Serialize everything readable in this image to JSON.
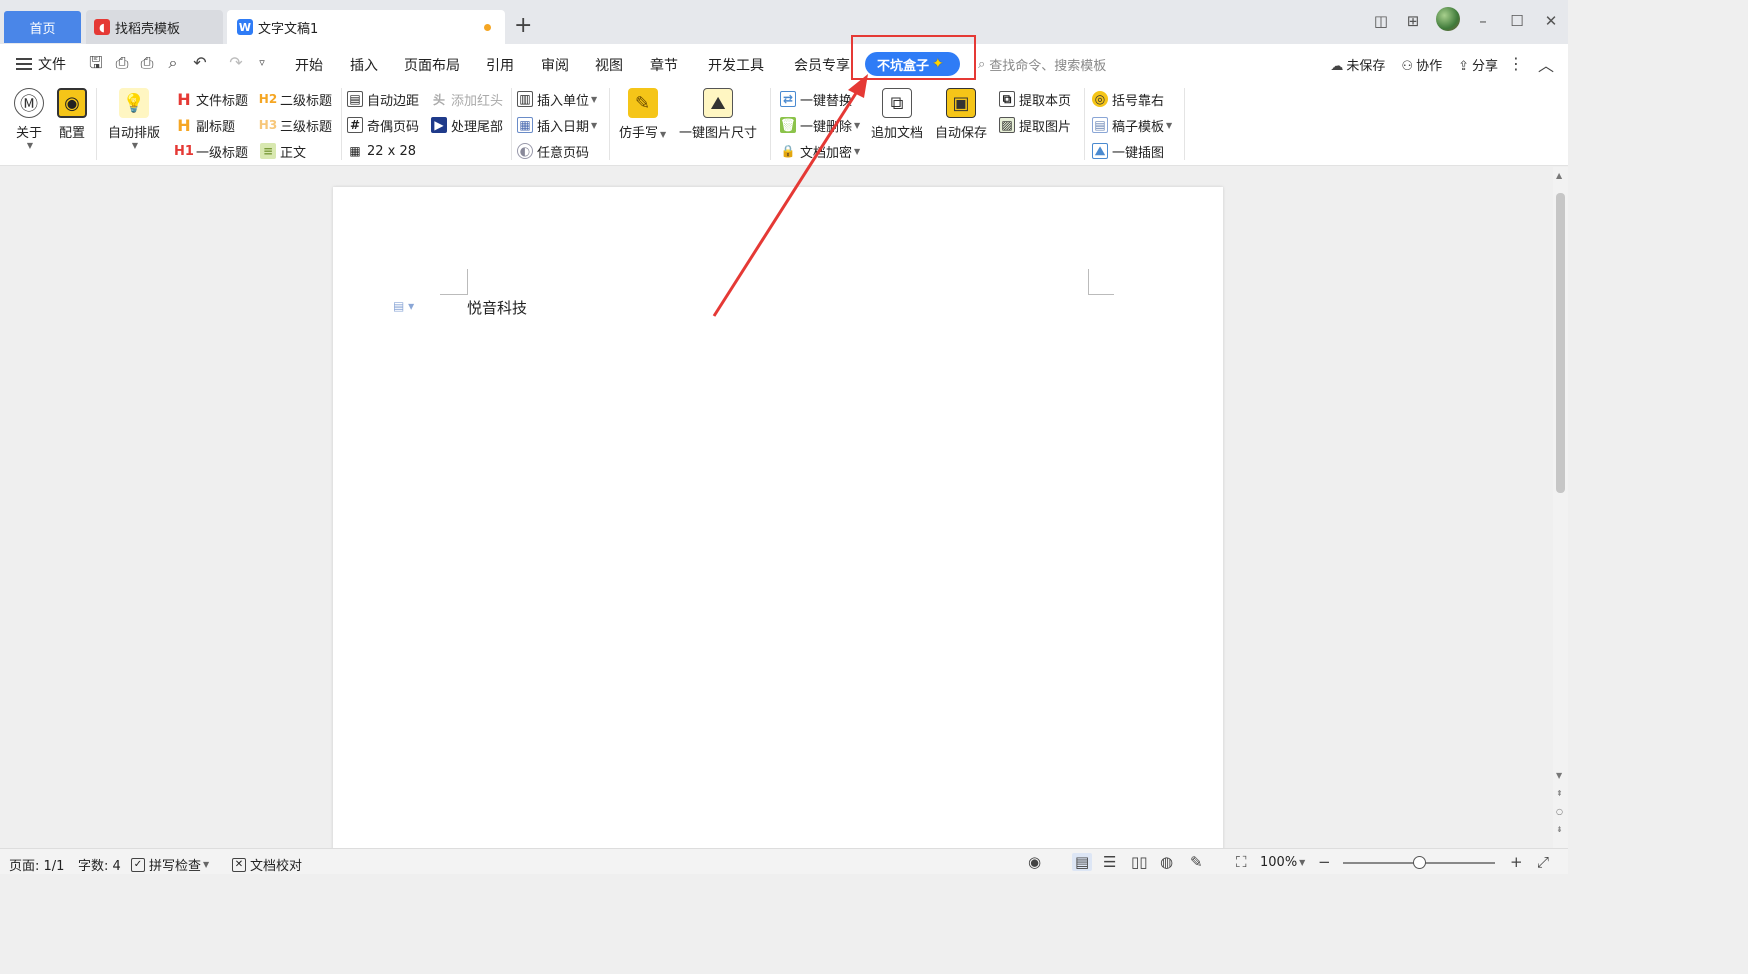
{
  "tabs": {
    "home": "首页",
    "template": "找稻壳模板",
    "document": "文字文稿1"
  },
  "menubar": {
    "file": "文件",
    "tabs": [
      "开始",
      "插入",
      "页面布局",
      "引用",
      "审阅",
      "视图",
      "章节",
      "开发工具",
      "会员专享"
    ],
    "active_plugin": "不坑盒子",
    "search_placeholder": "查找命令、搜索模板",
    "unsaved": "未保存",
    "collaborate": "协作",
    "share": "分享"
  },
  "ribbon": {
    "about": "关于",
    "config": "配置",
    "auto_layout": "自动排版",
    "doc_title": "文件标题",
    "subtitle": "副标题",
    "h1": "一级标题",
    "h2": "二级标题",
    "h3": "三级标题",
    "body": "正文",
    "auto_margin": "自动边距",
    "odd_even_page": "奇偶页码",
    "grid": "22 x 28",
    "add_header_red": "添加红头",
    "handle_tail": "处理尾部",
    "insert_unit": "插入单位",
    "insert_date": "插入日期",
    "any_page_num": "任意页码",
    "imitate_hand": "仿手写",
    "img_size": "一键图片尺寸",
    "one_replace": "一键替换",
    "one_delete": "一键删除",
    "doc_encrypt": "文档加密",
    "append_doc": "追加文档",
    "auto_save": "自动保存",
    "extract_page": "提取本页",
    "extract_img": "提取图片",
    "bracket_right": "括号靠右",
    "draft_template": "稿子模板",
    "one_illustration": "一键插图"
  },
  "document": {
    "text": "悦音科技"
  },
  "statusbar": {
    "page": "页面: 1/1",
    "words": "字数: 4",
    "spell_check": "拼写检查",
    "doc_proof": "文档校对",
    "zoom": "100%"
  },
  "colors": {
    "accent_blue": "#2f7cf6",
    "highlight_red": "#e53935"
  },
  "zoom_slider_level": 0.5
}
